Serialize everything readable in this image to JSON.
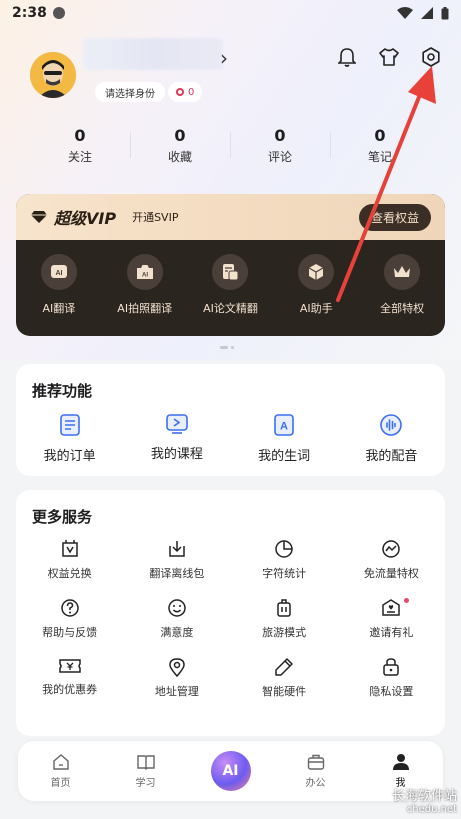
{
  "status_bar": {
    "time": "2:38"
  },
  "profile": {
    "identity_chip": "请选择身份",
    "badge_count": "0",
    "chevron": "›"
  },
  "stats": [
    {
      "num": "0",
      "label": "关注"
    },
    {
      "num": "0",
      "label": "收藏"
    },
    {
      "num": "0",
      "label": "评论"
    },
    {
      "num": "0",
      "label": "笔记"
    }
  ],
  "vip": {
    "title": "超级VIP",
    "subtitle": "开通SVIP",
    "button": "查看权益",
    "items": [
      {
        "label": "AI翻译",
        "icon": "ai-translate-icon"
      },
      {
        "label": "AI拍照翻译",
        "icon": "camera-icon"
      },
      {
        "label": "AI论文精翻",
        "icon": "paper-icon"
      },
      {
        "label": "AI助手",
        "icon": "cube-icon"
      },
      {
        "label": "全部特权",
        "icon": "crown-icon"
      }
    ]
  },
  "recommended": {
    "title": "推荐功能",
    "items": [
      {
        "label": "我的订单",
        "icon": "order-icon"
      },
      {
        "label": "我的课程",
        "icon": "course-icon"
      },
      {
        "label": "我的生词",
        "icon": "vocab-icon"
      },
      {
        "label": "我的配音",
        "icon": "audio-icon"
      }
    ]
  },
  "more": {
    "title": "更多服务",
    "items": [
      {
        "label": "权益兑换",
        "icon": "redeem-icon"
      },
      {
        "label": "翻译离线包",
        "icon": "download-icon"
      },
      {
        "label": "字符统计",
        "icon": "pie-icon"
      },
      {
        "label": "免流量特权",
        "icon": "trend-icon"
      },
      {
        "label": "帮助与反馈",
        "icon": "help-icon"
      },
      {
        "label": "满意度",
        "icon": "smile-icon"
      },
      {
        "label": "旅游模式",
        "icon": "luggage-icon"
      },
      {
        "label": "邀请有礼",
        "icon": "invite-icon"
      },
      {
        "label": "我的优惠券",
        "icon": "coupon-icon"
      },
      {
        "label": "地址管理",
        "icon": "location-icon"
      },
      {
        "label": "智能硬件",
        "icon": "pen-icon"
      },
      {
        "label": "隐私设置",
        "icon": "lock-icon"
      }
    ]
  },
  "nav": [
    {
      "label": "首页",
      "icon": "home-icon"
    },
    {
      "label": "学习",
      "icon": "book-icon"
    },
    {
      "label": "",
      "icon": "ai-icon",
      "glyph": "AI"
    },
    {
      "label": "办公",
      "icon": "briefcase-icon"
    },
    {
      "label": "我",
      "icon": "person-icon"
    }
  ],
  "watermark": {
    "text": "长海软件站",
    "url": "chedu.net"
  },
  "colors": {
    "accent_red": "#e0365a",
    "vip_dark": "#2b2520",
    "vip_gold": "#f7e4cc",
    "annotation_arrow": "#e8413a"
  }
}
